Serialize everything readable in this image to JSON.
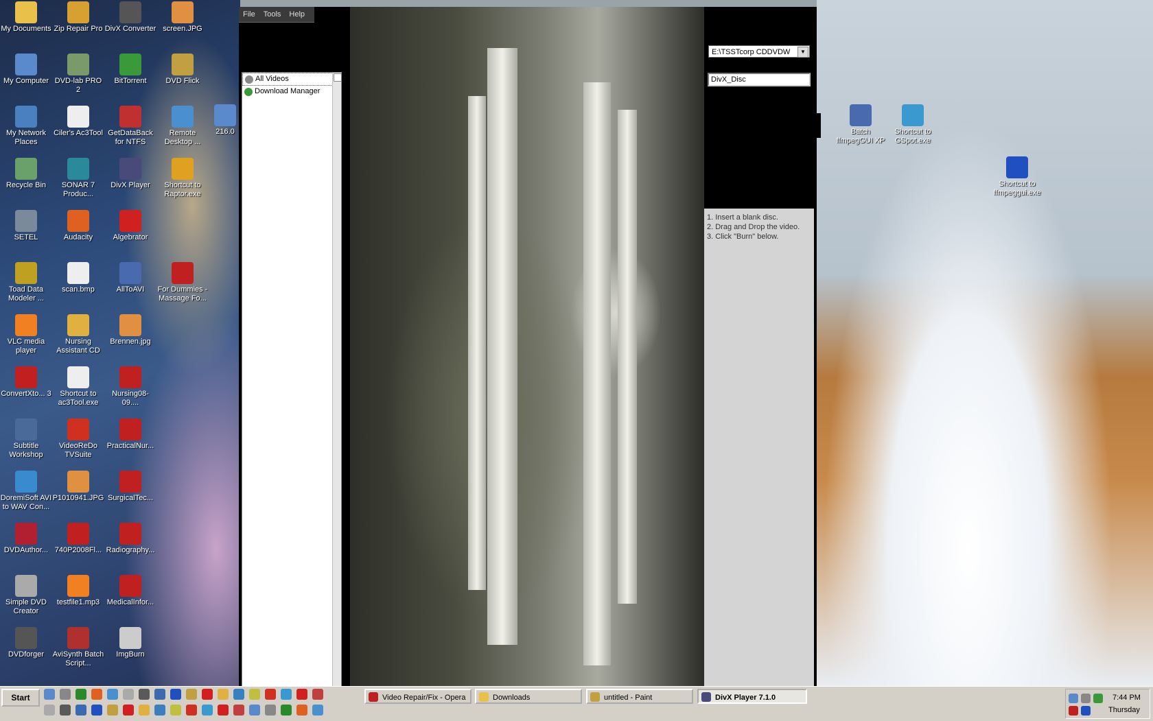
{
  "desktop": {
    "icons": [
      {
        "label": "My Documents",
        "glyph": "folder-icon",
        "color": "#e8c04a"
      },
      {
        "label": "Zip Repair Pro",
        "glyph": "zip-icon",
        "color": "#d8a030"
      },
      {
        "label": "DivX Converter",
        "glyph": "camera-icon",
        "color": "#555"
      },
      {
        "label": "screen.JPG",
        "glyph": "image-file-icon",
        "color": "#e09040"
      },
      {
        "label": "My Computer",
        "glyph": "computer-icon",
        "color": "#5a8acc"
      },
      {
        "label": "DVD-lab PRO 2",
        "glyph": "dvd-icon",
        "color": "#7a9a6a"
      },
      {
        "label": "BitTorrent",
        "glyph": "bittorrent-icon",
        "color": "#3a9a3a"
      },
      {
        "label": "DVD Flick",
        "glyph": "film-icon",
        "color": "#c0a040"
      },
      {
        "label": "My Network Places",
        "glyph": "network-icon",
        "color": "#4a80c0"
      },
      {
        "label": "Ciler's Ac3Tool",
        "glyph": "tool-icon",
        "color": "#eee"
      },
      {
        "label": "GetDataBack for NTFS",
        "glyph": "lifebuoy-icon",
        "color": "#c03030"
      },
      {
        "label": "Remote Desktop ...",
        "glyph": "remote-desktop-icon",
        "color": "#4a90d0"
      },
      {
        "label": "Recycle Bin",
        "glyph": "recycle-bin-icon",
        "color": "#6aa06a"
      },
      {
        "label": "SONAR 7 Produc...",
        "glyph": "sonar-icon",
        "color": "#2a8a9a"
      },
      {
        "label": "DivX Player",
        "glyph": "divx-player-icon",
        "color": "#4a4a7a"
      },
      {
        "label": "Shortcut to Raptor.exe",
        "glyph": "raptor-icon",
        "color": "#e0a020"
      },
      {
        "label": "SETEL",
        "glyph": "setel-icon",
        "color": "#7a8a9a"
      },
      {
        "label": "Audacity",
        "glyph": "audacity-icon",
        "color": "#e06020"
      },
      {
        "label": "Algebrator",
        "glyph": "algebrator-icon",
        "color": "#d02020"
      },
      {
        "label": "Toad Data Modeler ...",
        "glyph": "toad-icon",
        "color": "#c0a020"
      },
      {
        "label": "scan.bmp",
        "glyph": "bitmap-file-icon",
        "color": "#eee"
      },
      {
        "label": "AllToAVI",
        "glyph": "avi-icon",
        "color": "#4a6ab0"
      },
      {
        "label": "For Dummies - Massage Fo...",
        "glyph": "pdf-icon",
        "color": "#c02020"
      },
      {
        "label": "VLC media player",
        "glyph": "vlc-cone-icon",
        "color": "#f08020"
      },
      {
        "label": "Nursing Assistant CD",
        "glyph": "cd-folder-icon",
        "color": "#e0b040"
      },
      {
        "label": "Brennen.jpg",
        "glyph": "image-file-icon",
        "color": "#e09040"
      },
      {
        "label": "ConvertXto... 3",
        "glyph": "convertx-icon",
        "color": "#c02020"
      },
      {
        "label": "Shortcut to ac3Tool.exe",
        "glyph": "tool-icon",
        "color": "#eee"
      },
      {
        "label": "Nursing08-09....",
        "glyph": "pdf-icon",
        "color": "#c02020"
      },
      {
        "label": "Subtitle Workshop",
        "glyph": "subtitle-icon",
        "color": "#4a6a9a"
      },
      {
        "label": "VideoReDo TVSuite",
        "glyph": "videoredo-icon",
        "color": "#d03020"
      },
      {
        "label": "PracticalNur...",
        "glyph": "pdf-icon",
        "color": "#c02020"
      },
      {
        "label": "DoremiSoft AVI to WAV Con...",
        "glyph": "doremisoft-icon",
        "color": "#3a8ad0"
      },
      {
        "label": "P1010941.JPG",
        "glyph": "image-file-icon",
        "color": "#e09040"
      },
      {
        "label": "SurgicalTec...",
        "glyph": "pdf-icon",
        "color": "#c02020"
      },
      {
        "label": "DVDAuthor...",
        "glyph": "dvdauthor-icon",
        "color": "#b02030"
      },
      {
        "label": "740P2008Fl...",
        "glyph": "pdf-icon",
        "color": "#c02020"
      },
      {
        "label": "Radiography...",
        "glyph": "pdf-icon",
        "color": "#c02020"
      },
      {
        "label": "Simple DVD Creator",
        "glyph": "disc-icon",
        "color": "#aaa"
      },
      {
        "label": "testfile1.mp3",
        "glyph": "vlc-cone-icon",
        "color": "#f08020"
      },
      {
        "label": "MedicalInfor...",
        "glyph": "pdf-icon",
        "color": "#c02020"
      },
      {
        "label": "DVDforger",
        "glyph": "eye-icon",
        "color": "#555"
      },
      {
        "label": "AviSynth Batch Script...",
        "glyph": "avisynth-icon",
        "color": "#b03030"
      },
      {
        "label": "ImgBurn",
        "glyph": "imgburn-icon",
        "color": "#ccc"
      },
      {
        "label": "216.0",
        "glyph": "computer-icon",
        "color": "#5a8acc"
      },
      {
        "label": "Batch ffmpegGUI XP",
        "glyph": "batch-icon",
        "color": "#4a6ab0"
      },
      {
        "label": "Shortcut to GSpot.exe",
        "glyph": "gspot-icon",
        "color": "#3a9ad0"
      },
      {
        "label": "Shortcut to ffmpeggui.exe",
        "glyph": "ffmpeg-icon",
        "color": "#2050c0"
      }
    ]
  },
  "divx_window": {
    "menu": [
      "File",
      "Tools",
      "Help"
    ],
    "sidebar_items": [
      {
        "label": "All Videos",
        "selected": true,
        "icon": "all-videos-icon",
        "color": "#888"
      },
      {
        "label": "Download Manager",
        "selected": false,
        "icon": "download-icon",
        "color": "#3a9a3a"
      }
    ],
    "drive_select": "E:\\TSSTcorp CDDVDW",
    "disc_name": "DivX_Disc",
    "instructions": [
      "1. Insert a blank disc.",
      "2. Drag and Drop the video.",
      "3. Click \"Burn\" below."
    ]
  },
  "taskbar": {
    "start_label": "Start",
    "tasks": [
      {
        "label": "Video Repair/Fix - Opera",
        "icon": "opera-icon",
        "color": "#c02020",
        "active": false
      },
      {
        "label": "Downloads",
        "icon": "folder-icon",
        "color": "#e8c04a",
        "active": false
      },
      {
        "label": "untitled - Paint",
        "icon": "paint-icon",
        "color": "#c0a040",
        "active": false
      },
      {
        "label": "DivX Player 7.1.0",
        "icon": "divx-player-icon",
        "color": "#4a4a7a",
        "active": true
      }
    ],
    "time": "7:44 PM",
    "day": "Thursday"
  }
}
